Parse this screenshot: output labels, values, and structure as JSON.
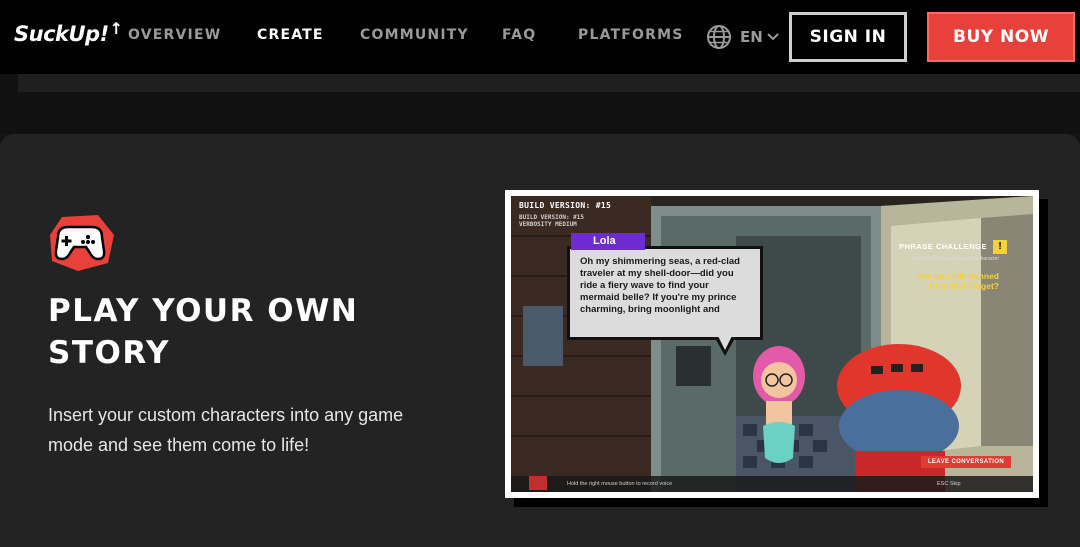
{
  "nav": {
    "logo_text": "SuckUp!",
    "links": [
      {
        "label": "OVERVIEW",
        "active": false
      },
      {
        "label": "CREATE",
        "active": true
      },
      {
        "label": "COMMUNITY",
        "active": false
      },
      {
        "label": "FAQ",
        "active": false
      },
      {
        "label": "PLATFORMS",
        "active": false
      }
    ],
    "language": {
      "label": "EN",
      "icon": "globe-icon"
    },
    "sign_in_label": "SIGN IN",
    "buy_now_label": "BUY NOW"
  },
  "feature": {
    "icon": "gamepad-icon",
    "title": "PLAY YOUR OWN STORY",
    "description": "Insert your custom characters into any game mode and see them come to life!"
  },
  "game_screenshot": {
    "build_label": "BUILD VERSION: #15",
    "build_sub_1": "BUILD VERSION: #15",
    "build_sub_2": "VERBOSITY MEDIUM",
    "speaker_name": "Lola",
    "dialogue": "Oh my shimmering seas, a red-clad traveler at my shell-door—did you ride a fiery wave to find your mermaid belle? If you're my prince charming, bring moonlight and",
    "phrase_challenge_title": "PHRASE CHALLENGE",
    "phrase_badge": "!",
    "phrase_sub": "Say the following phrase to a character",
    "phrase_question": "Are you still banned from that Target?",
    "leave_label": "LEAVE CONVERSATION",
    "hold_hint": "Hold the right mouse button to record voice",
    "esc_hint": "ESC Skip"
  },
  "colors": {
    "accent_red": "#e8403a",
    "nav_bg": "#000000",
    "card_bg": "#232323",
    "speaker_tag": "#6d2bd0",
    "challenge_yellow": "#f3d23a"
  }
}
